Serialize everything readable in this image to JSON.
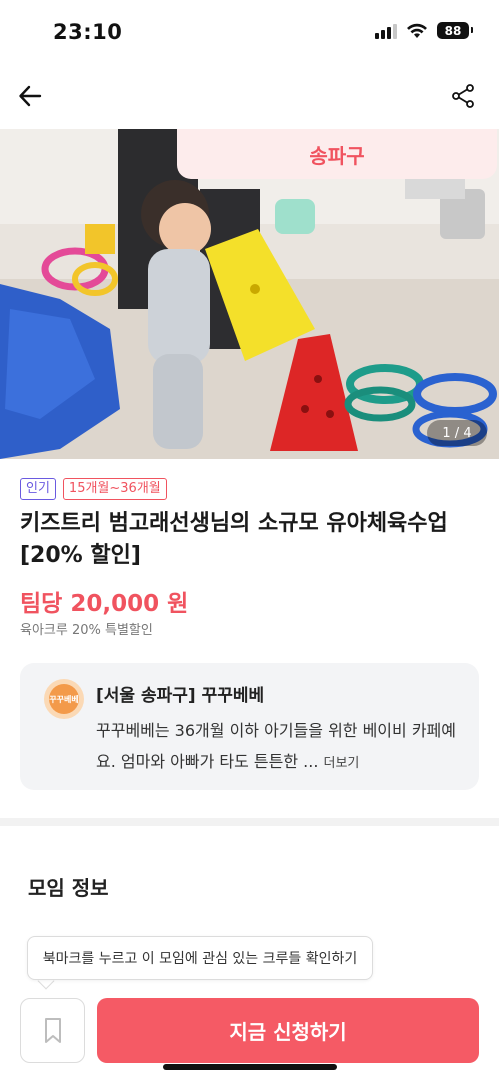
{
  "status_bar": {
    "time": "23:10",
    "battery": "88",
    "icons": [
      "signal-icon",
      "wifi-icon",
      "battery-icon"
    ]
  },
  "nav": {
    "back_icon": "arrow-left-icon",
    "share_icon": "share-icon"
  },
  "hero": {
    "region_badge": "송파구",
    "page_indicator": "1 / 4"
  },
  "tags": {
    "popular": "인기",
    "age": "15개월~36개월"
  },
  "class": {
    "title": "키즈트리 범고래선생님의 소규모 유아체육수업 [20% 할인]",
    "price": "팀당 20,000 원",
    "discount_note": "육아크루 20% 특별할인"
  },
  "host": {
    "avatar_text": "꾸꾸베베",
    "name": "[서울 송파구] 꾸꾸베베",
    "description": "꾸꾸베베는 36개월 이하 아기들을 위한 베이비 카페예요. 엄마와 아빠가 타도 튼튼한 ...",
    "more_label": "더보기"
  },
  "section": {
    "title": "모임 정보"
  },
  "tooltip": {
    "text": "북마크를 누르고 이 모임에 관심 있는 크루들 확인하기"
  },
  "bottom": {
    "bookmark_icon": "bookmark-icon",
    "apply_label": "지금 신청하기"
  },
  "colors": {
    "accent": "#f0535f",
    "apply_button": "#f55a65",
    "popular_tag": "#6a5ae0",
    "card_bg": "#f3f4f6"
  }
}
